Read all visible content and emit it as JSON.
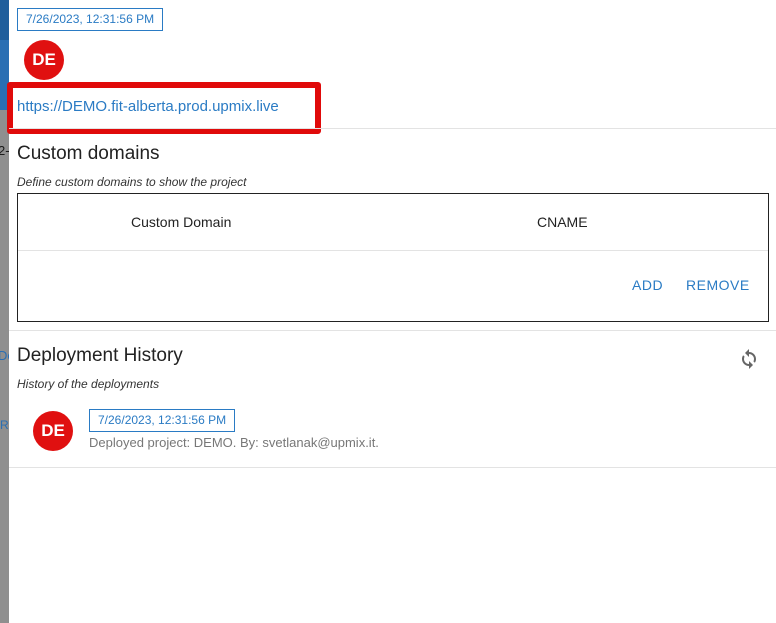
{
  "background": {
    "fragments": [
      "2-",
      "De",
      "R"
    ]
  },
  "header": {
    "timestamp": "7/26/2023, 12:31:56 PM",
    "avatar_initials": "DE",
    "url": "https://DEMO.fit-alberta.prod.upmix.live"
  },
  "custom_domains": {
    "title": "Custom domains",
    "subtitle": "Define custom domains to show the project",
    "columns": [
      "Custom Domain",
      "CNAME"
    ],
    "add_label": "ADD",
    "remove_label": "REMOVE"
  },
  "deployment_history": {
    "title": "Deployment History",
    "subtitle": "History of the deployments",
    "refresh_icon": "refresh-icon",
    "items": [
      {
        "avatar_initials": "DE",
        "timestamp": "7/26/2023, 12:31:56 PM",
        "description": "Deployed project: DEMO. By: svetlanak@upmix.it."
      }
    ]
  },
  "colors": {
    "accent": "#2a7bc4",
    "avatar": "#e01010",
    "highlight": "#e00a0a"
  }
}
